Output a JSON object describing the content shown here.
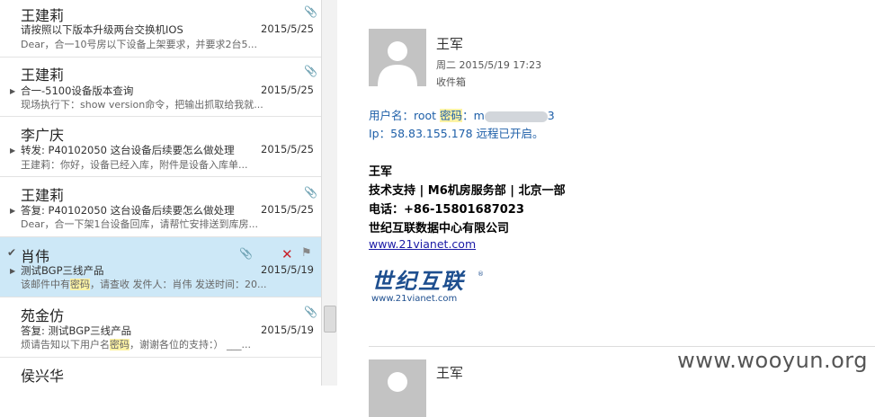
{
  "emails": [
    {
      "sender": "王建莉",
      "subject": "请按照以下版本升级两台交换机IOS",
      "date": "2015/5/25",
      "preview": "Dear，合一10号房以下设备上架要求，并要求2台5..."
    },
    {
      "sender": "王建莉",
      "subject": "合一-5100设备版本查询",
      "date": "2015/5/25",
      "preview": "现场执行下：show version命令，把输出抓取给我就..."
    },
    {
      "sender": "李广庆",
      "subject": "转发: P40102050 这台设备后续要怎么做处理",
      "date": "2015/5/25",
      "preview": "王建莉：你好，设备已经入库，附件是设备入库单..."
    },
    {
      "sender": "王建莉",
      "subject": "答复: P40102050 这台设备后续要怎么做处理",
      "date": "2015/5/25",
      "preview": "Dear，合一下架1台设备回库，请帮忙安排送到库房..."
    },
    {
      "sender": "肖伟",
      "subject": "测试BGP三线产品",
      "date": "2015/5/19",
      "preview_pre": "该邮件中有",
      "preview_hl": "密码",
      "preview_post": "，请查收   发件人：肖伟  发送时间：20..."
    },
    {
      "sender": "苑金仿",
      "subject": "答复: 测试BGP三线产品",
      "date": "2015/5/19",
      "preview_pre": "烦请告知以下用户名",
      "preview_hl": "密码",
      "preview_post": "，谢谢各位的支持：）   ___..."
    },
    {
      "sender": "侯兴华"
    }
  ],
  "reading": {
    "sender": "王军",
    "datetime": "周二 2015/5/19 17:23",
    "folder": "收件箱",
    "user_label": "用户名：root  ",
    "pwd_hl": "密码",
    "pwd_colon": "：m",
    "pwd_tail": "3",
    "ip_line": "Ip：58.83.155.178 远程已开启。",
    "sig_name": "王军",
    "sig_dept": "技术支持 | M6机房服务部 | 北京一部",
    "sig_phone": "电话：+86-15801687023",
    "sig_company": "世纪互联数据中心有限公司",
    "sig_link": "www.21vianet.com",
    "logo_cn": "世纪互联",
    "logo_url": "www.21vianet.com",
    "second_sender": "王军"
  },
  "watermark": "www.wooyun.org"
}
